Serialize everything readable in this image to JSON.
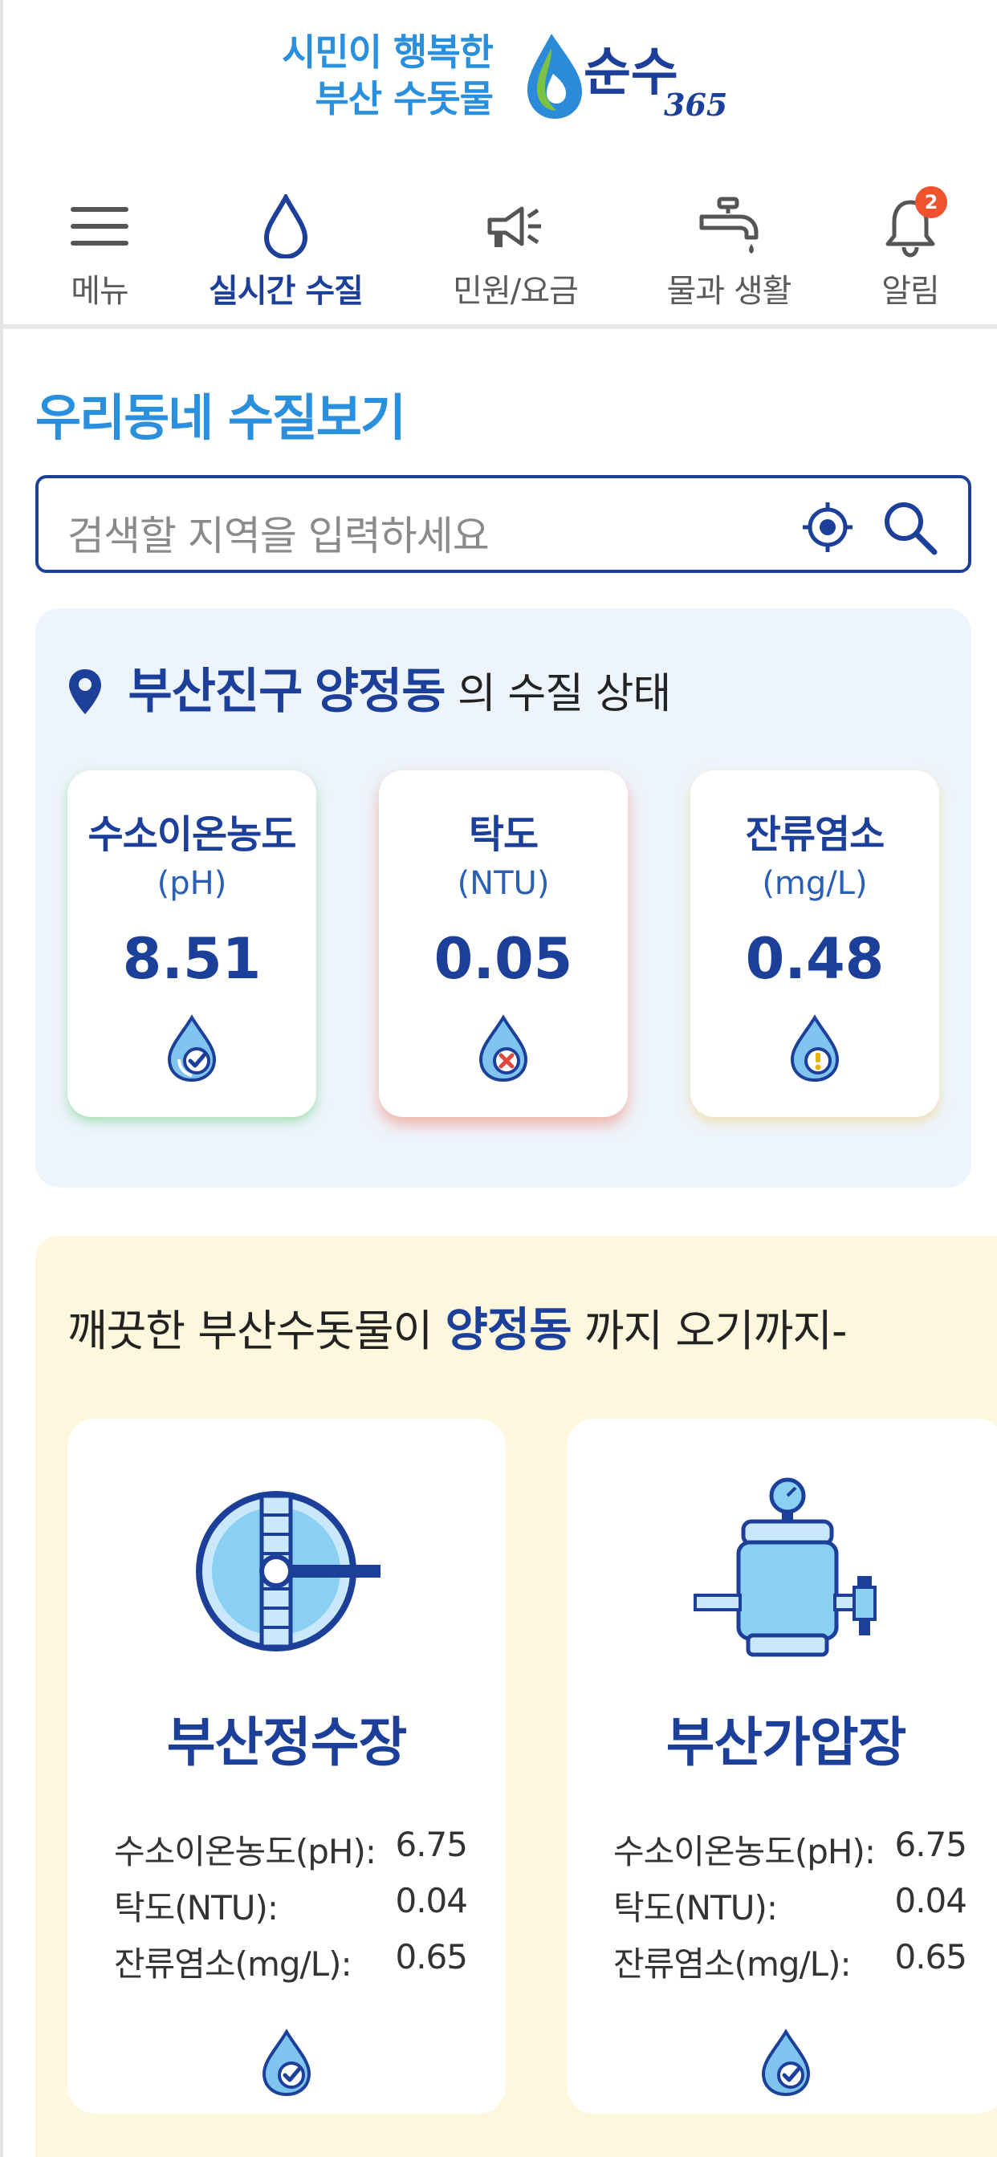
{
  "header": {
    "slogan_line1": "시민이 행복한",
    "slogan_line2": "부산 수돗물",
    "logo_text": "순수",
    "logo_number": "365"
  },
  "nav": {
    "items": [
      {
        "label": "메뉴",
        "icon": "menu-icon"
      },
      {
        "label": "실시간 수질",
        "icon": "water-drop-icon",
        "active": true
      },
      {
        "label": "민원/요금",
        "icon": "megaphone-icon"
      },
      {
        "label": "물과 생활",
        "icon": "faucet-icon"
      },
      {
        "label": "알림",
        "icon": "bell-icon",
        "badge": "2"
      }
    ]
  },
  "section_title": "우리동네 수질보기",
  "search": {
    "placeholder": "검색할 지역을 입력하세요"
  },
  "status": {
    "district": "부산진구",
    "dong": "양정동",
    "suffix": "의 수질 상태",
    "metrics": [
      {
        "title": "수소이온농도",
        "unit": "(pH)",
        "value": "8.51",
        "state": "good",
        "color": "#7fd88f"
      },
      {
        "title": "탁도",
        "unit": "(NTU)",
        "value": "0.05",
        "state": "bad",
        "color": "#f08c78"
      },
      {
        "title": "잔류염소",
        "unit": "(mg/L)",
        "value": "0.48",
        "state": "caution",
        "color": "#f0d282"
      }
    ]
  },
  "path": {
    "prefix": "깨끗한 부산수돗물이",
    "dong": "양정동",
    "suffix": "까지 오기까지-",
    "plants": [
      {
        "name": "부산정수장",
        "icon": "purification-plant-icon",
        "rows": [
          {
            "label": "수소이온농도(pH):",
            "value": "6.75"
          },
          {
            "label": "탁도(NTU):",
            "value": "0.04"
          },
          {
            "label": "잔류염소(mg/L):",
            "value": "0.65"
          }
        ]
      },
      {
        "name": "부산가압장",
        "icon": "pressurization-station-icon",
        "rows": [
          {
            "label": "수소이온농도(pH):",
            "value": "6.75"
          },
          {
            "label": "탁도(NTU):",
            "value": "0.04"
          },
          {
            "label": "잔류염소(mg/L):",
            "value": "0.65"
          }
        ]
      }
    ]
  },
  "colors": {
    "primary": "#1c3f9a",
    "accent": "#2a8fdc",
    "panel": "#eef4fb",
    "path_panel": "#fdf8dd",
    "badge": "#f0522f"
  }
}
